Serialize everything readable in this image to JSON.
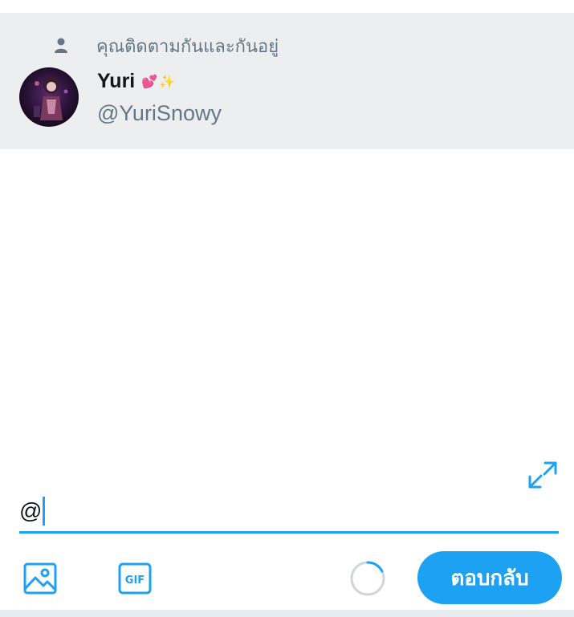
{
  "suggestion": {
    "follow_text": "คุณติดตามกันและกันอยู่",
    "user": {
      "display_name": "Yuri",
      "emojis": [
        "💕",
        "✨"
      ],
      "handle": "@YuriSnowy"
    }
  },
  "composer": {
    "input_value": "@"
  },
  "toolbar": {
    "gif_label": "GIF",
    "reply_label": "ตอบกลับ"
  },
  "icons": {
    "person": "person-icon",
    "expand": "expand-icon",
    "image": "image-icon",
    "gif": "gif-icon",
    "progress": "character-count-ring"
  },
  "colors": {
    "accent": "#1da1f2",
    "suggestion_bg": "#eceef0",
    "muted_text": "#657786",
    "primary_text": "#14171a"
  }
}
